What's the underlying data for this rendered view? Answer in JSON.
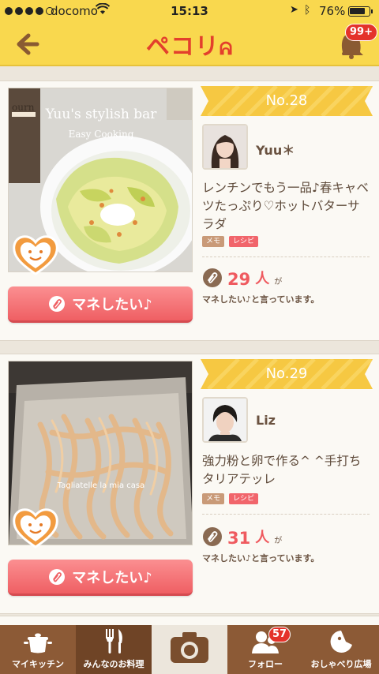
{
  "status_bar": {
    "carrier": "docomo",
    "time": "15:13",
    "battery": "76%",
    "signal_icon": "signal-dots-icon",
    "wifi_icon": "wifi-icon",
    "location_icon": "location-arrow-icon",
    "bluetooth_icon": "bluetooth-icon",
    "battery_icon": "battery-icon"
  },
  "nav": {
    "logo": "ペコリ",
    "back_icon": "back-arrow-icon",
    "notification_icon": "bell-icon",
    "notification_badge": "99+"
  },
  "colors": {
    "header": "#f9d84e",
    "accent_red": "#ef5a5f",
    "ribbon": "#f6c842",
    "tabbar": "#8c5a36"
  },
  "feed": [
    {
      "rank": "No.28",
      "user": "Yuu＊",
      "description": "レンチンでもう一品♪春キャベツたっぷり♡ホットバターサラダ",
      "tags": [
        "メモ",
        "レシピ"
      ],
      "count": "29",
      "count_unit": "人",
      "count_suffix": "が",
      "count_sub": "マネしたい♪と言っています。",
      "photo_title": "Yuu's stylish bar",
      "photo_subtitle": "Easy Cooking",
      "photo_side_text": "ourn",
      "button_label": "マネしたい♪"
    },
    {
      "rank": "No.29",
      "user": "Liz",
      "description": "強力粉と卵で作る^ ^手打ちタリアテッレ",
      "tags": [
        "メモ",
        "レシピ"
      ],
      "count": "31",
      "count_unit": "人",
      "count_suffix": "が",
      "count_sub": "マネしたい♪と言っています。",
      "photo_title": "Tagliatelle la mia casa",
      "button_label": "マネしたい♪"
    }
  ],
  "tabs": [
    {
      "label": "マイキッチン",
      "icon": "pot-icon"
    },
    {
      "label": "みんなのお料理",
      "icon": "fork-knife-icon"
    },
    {
      "label": "",
      "icon": "camera-icon"
    },
    {
      "label": "フォロー",
      "icon": "follow-people-icon",
      "badge": "57"
    },
    {
      "label": "おしゃべり広場",
      "icon": "chat-face-icon"
    }
  ]
}
